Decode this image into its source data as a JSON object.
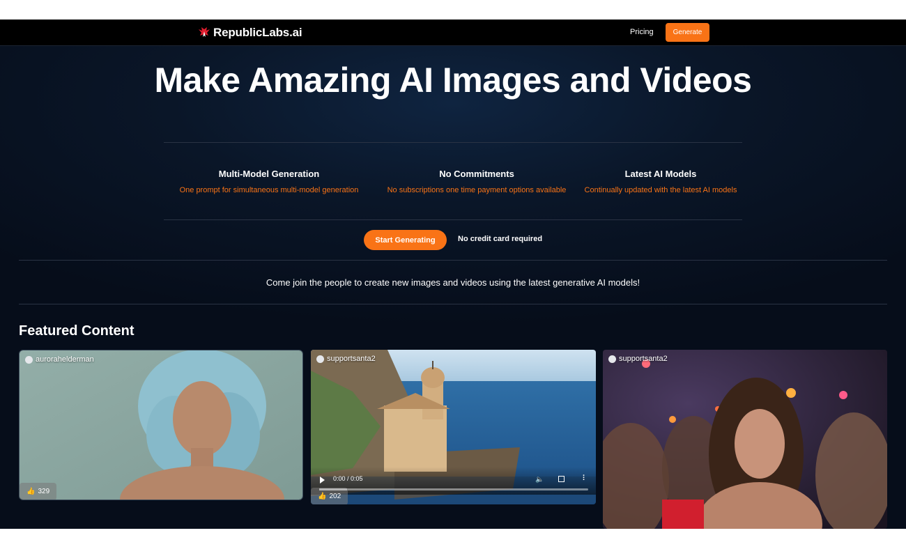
{
  "nav": {
    "brand": "RepublicLabs.ai",
    "pricing": "Pricing",
    "generate": "Generate"
  },
  "hero": {
    "title": "Make Amazing AI Images and Videos"
  },
  "features": [
    {
      "title": "Multi-Model Generation",
      "desc": "One prompt for simultaneous multi-model generation"
    },
    {
      "title": "No Commitments",
      "desc": "No subscriptions one time payment options available"
    },
    {
      "title": "Latest AI Models",
      "desc": "Continually updated with the latest AI models"
    }
  ],
  "cta": {
    "button": "Start Generating",
    "note": "No credit card required"
  },
  "join_text": "Come join the people to create new images and videos using the latest generative AI models!",
  "featured": {
    "title": "Featured Content",
    "cards": [
      {
        "user": "aurorahelderman",
        "likes": "329",
        "like_icon": "thumbs-up-icon"
      },
      {
        "user": "supportsanta2",
        "likes": "202",
        "like_icon": "thumbs-up-icon",
        "video_time": "0:00 / 0:05"
      },
      {
        "user": "supportsanta2"
      }
    ]
  },
  "colors": {
    "accent": "#f97316",
    "background": "#0a1628",
    "topbar": "#000000"
  }
}
